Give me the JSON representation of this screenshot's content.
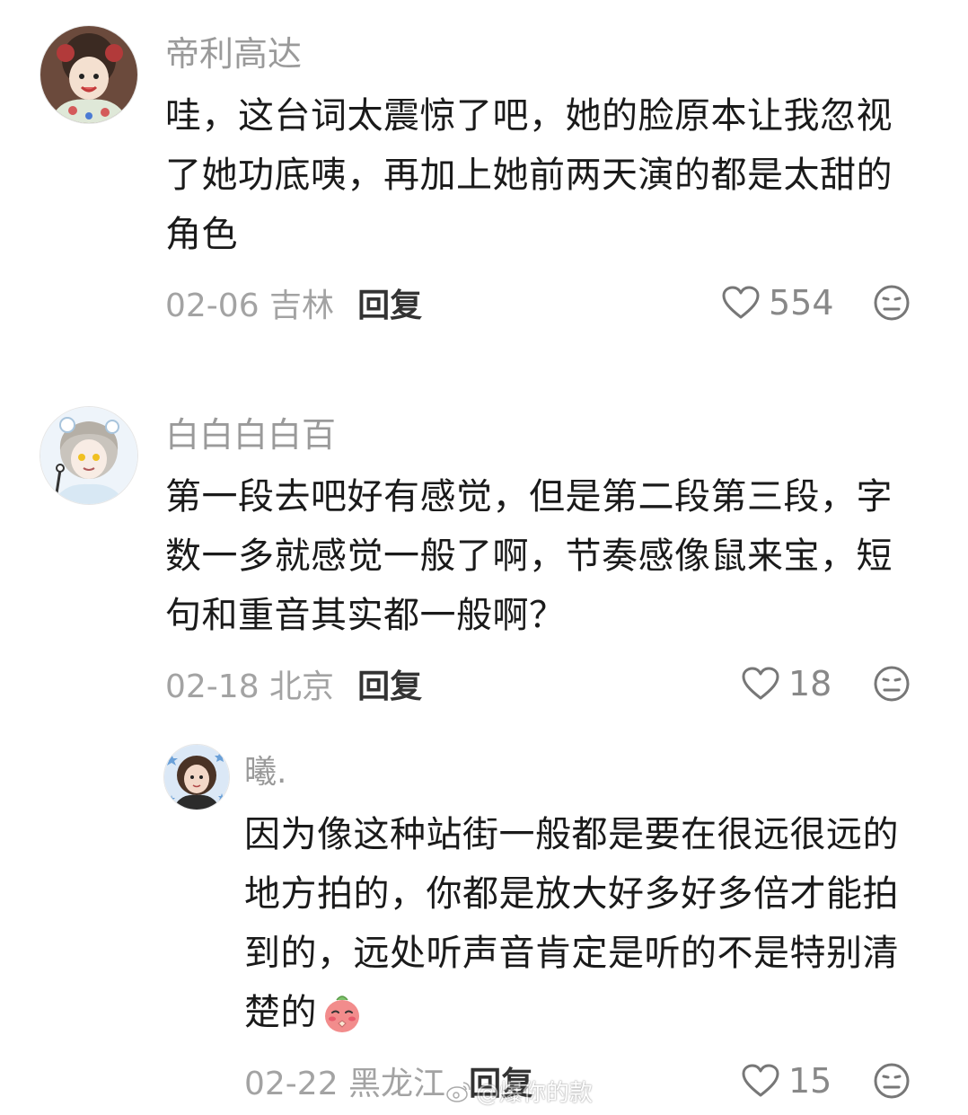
{
  "comments": [
    {
      "username": "帝利高达",
      "lines": [
        "哇，这台词太震惊了吧，她的脸原本让我忽视",
        "了她功底咦，再加上她前两天演的都是太甜的",
        "角色"
      ],
      "date_location": "02-06 吉林",
      "reply_label": "回复",
      "likes": "554",
      "avatar_icon": "avatar-girl-hanfu"
    },
    {
      "username": "白白白白百",
      "lines": [
        "第一段去吧好有感觉，但是第二段第三段，字",
        "数一多就感觉一般了啊，节奏感像鼠来宝，短",
        "句和重音其实都一般啊？"
      ],
      "date_location": "02-18 北京",
      "reply_label": "回复",
      "likes": "18",
      "avatar_icon": "avatar-anime-girl"
    },
    {
      "username": "曦.",
      "lines": [
        "因为像这种站街一般都是要在很远很远的",
        "地方拍的，你都是放大好多好多倍才能拍",
        "到的，远处听声音肯定是听的不是特别清",
        "楚的"
      ],
      "date_location": "02-22 黑龙江",
      "reply_label": "回复",
      "likes": "15",
      "avatar_icon": "avatar-photo-girl",
      "emoji_icon": "shy-emoji"
    }
  ],
  "icons": {
    "like": "heart-outline-icon",
    "reaction": "neutral-face-icon"
  },
  "watermark": {
    "text": "@爆你的款"
  }
}
